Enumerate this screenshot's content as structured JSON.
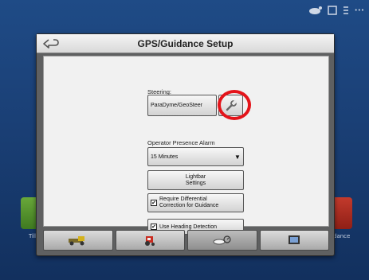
{
  "status_bar": {
    "icons": [
      "satellite-icon",
      "display-icon",
      "signal-icon"
    ],
    "signal_text": "•••"
  },
  "background": {
    "left_tile_label": "Till",
    "right_tile_label": "dance"
  },
  "dialog": {
    "title": "GPS/Guidance Setup",
    "steering_label": "Steering:",
    "steering_value": "ParaDyme/GeoSteer",
    "alarm_label": "Operator Presence Alarm",
    "alarm_value": "15 Minutes",
    "lightbar_line1": "Lightbar",
    "lightbar_line2": "Settings",
    "differential_line1": "Require Differential",
    "differential_line2": "Correction for Guidance",
    "differential_checked": true,
    "heading_label": "Use Heading Detection",
    "heading_checked": true
  },
  "tabs": [
    {
      "icon": "implement-icon",
      "active": false
    },
    {
      "icon": "tractor-icon",
      "active": false
    },
    {
      "icon": "gps-receiver-icon",
      "active": true
    },
    {
      "icon": "display-unit-icon",
      "active": false
    }
  ],
  "colors": {
    "highlight_ring": "#e4141a",
    "background": "#1f4b86",
    "dialog": "#5f6061"
  }
}
